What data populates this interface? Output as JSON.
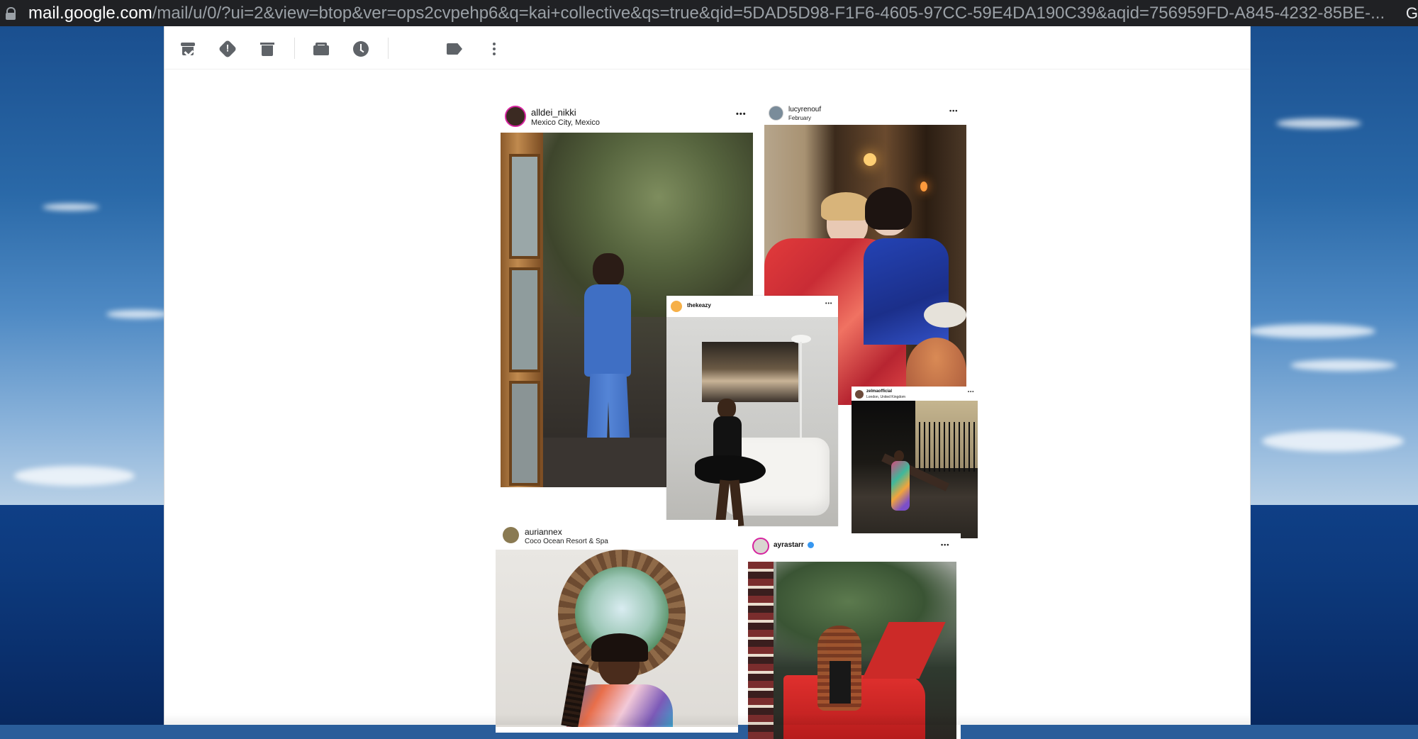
{
  "browser": {
    "url_host": "mail.google.com",
    "url_path": "/mail/u/0/?ui=2&view=btop&ver=ops2cvpehp6&q=kai+collective&qs=true&qid=5DAD5D98-F1F6-4605-97CC-59E4DA190C39&aqid=756959FD-A845-4232-85BE-...",
    "right_glyph": "G"
  },
  "toolbar": {
    "icons": [
      "archive-icon",
      "report-spam-icon",
      "delete-icon",
      "mark-as-read-icon",
      "snooze-icon",
      "label-icon",
      "more-vert-icon"
    ]
  },
  "posts": {
    "alldei": {
      "username": "alldei_nikki",
      "location": "Mexico City, Mexico",
      "more": "•••"
    },
    "lucy": {
      "username": "lucyrenouf",
      "location": "February",
      "more": "•••"
    },
    "thekeazy": {
      "username": "thekeazy",
      "more": "•••"
    },
    "zelma": {
      "username": "zelmaofficial",
      "location": "London, United Kingdom",
      "more": "•••"
    },
    "aurian": {
      "username": "auriannex",
      "location": "Coco Ocean Resort & Spa"
    },
    "ayra": {
      "username": "ayrastarr",
      "more": "•••"
    }
  },
  "colors": {
    "toolbar_icon": "#5f6368",
    "verified_badge": "#3797f0",
    "story_ring": "#d6249f"
  }
}
